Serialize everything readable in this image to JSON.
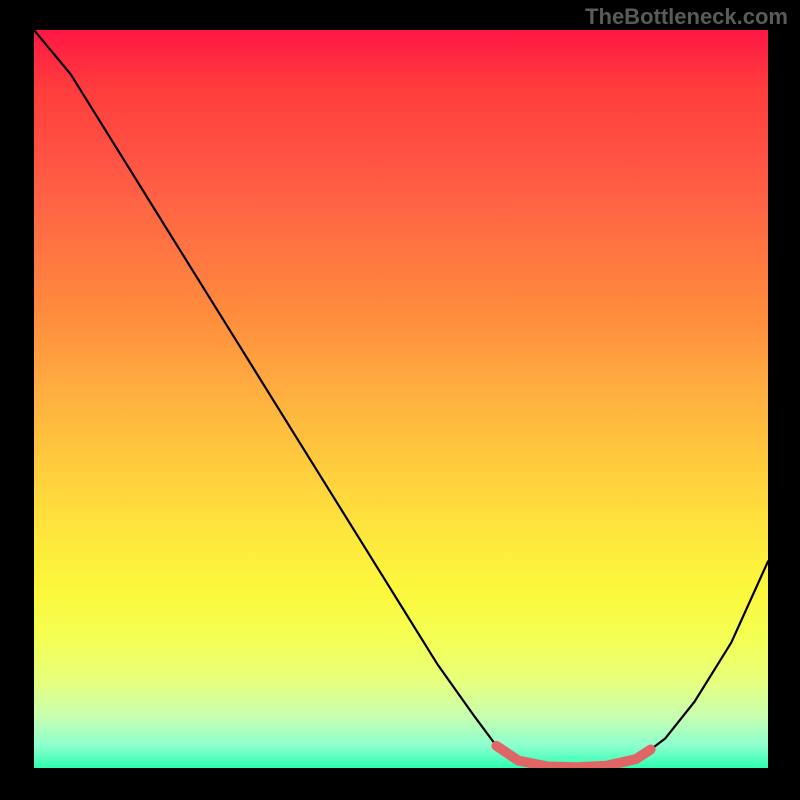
{
  "watermark": "TheBottleneck.com",
  "chart_data": {
    "type": "line",
    "title": "",
    "xlabel": "",
    "ylabel": "",
    "xlim": [
      0,
      100
    ],
    "ylim": [
      0,
      100
    ],
    "grid": false,
    "legend": false,
    "series": [
      {
        "name": "bottleneck-curve",
        "x": [
          0,
          5,
          10,
          15,
          20,
          25,
          30,
          35,
          40,
          45,
          50,
          55,
          60,
          63,
          66,
          70,
          74,
          78,
          82,
          86,
          90,
          95,
          100
        ],
        "y": [
          100,
          94,
          86,
          78,
          70,
          62,
          54,
          46,
          38,
          30,
          22,
          14,
          7,
          3,
          1,
          0,
          0,
          0,
          1,
          4,
          9,
          17,
          28
        ],
        "color": "#000000"
      },
      {
        "name": "optimal-zone",
        "x": [
          63,
          66,
          70,
          74,
          78,
          82,
          84
        ],
        "y": [
          3,
          1,
          0.2,
          0.1,
          0.3,
          1.2,
          2.5
        ],
        "color": "#e06666"
      }
    ],
    "gradient_stops": [
      {
        "pos": 0,
        "color": "#ff1744"
      },
      {
        "pos": 50,
        "color": "#ffc107"
      },
      {
        "pos": 80,
        "color": "#ffff4d"
      },
      {
        "pos": 100,
        "color": "#2effb0"
      }
    ]
  }
}
